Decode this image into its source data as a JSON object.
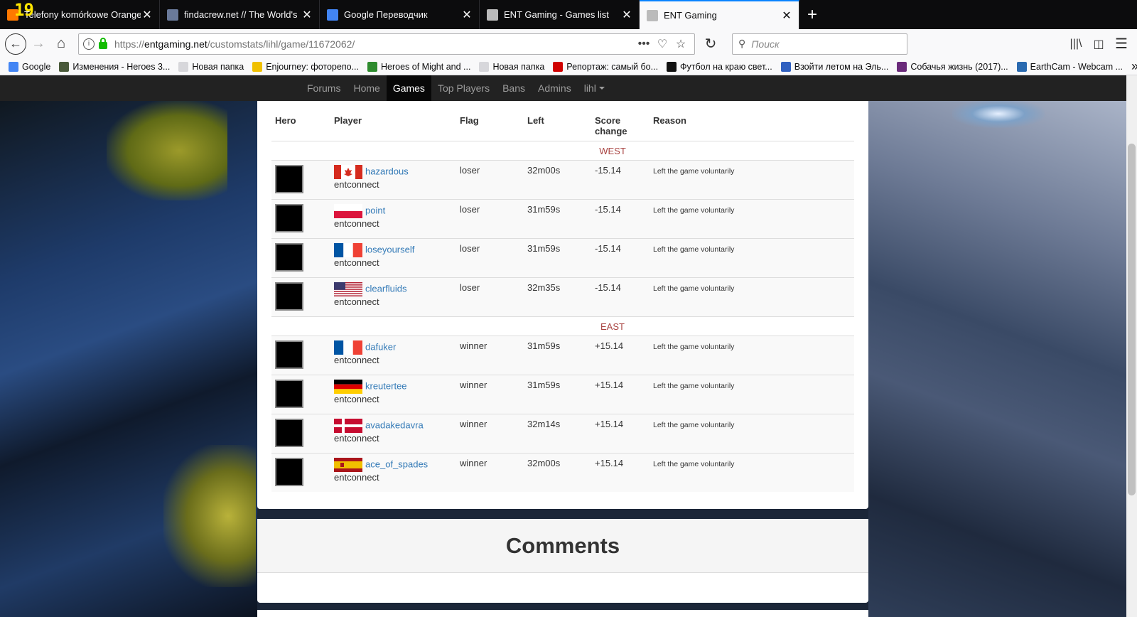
{
  "overlay_logo": "19",
  "browser": {
    "tabs": [
      {
        "title": "Telefony komórkowe Orange -",
        "favicon_color": "#ff7900",
        "active": false
      },
      {
        "title": "findacrew.net // The World's la",
        "favicon_color": "#6a7a9a",
        "active": false
      },
      {
        "title": "Google Переводчик",
        "favicon_color": "#4285f4",
        "active": false
      },
      {
        "title": "ENT Gaming - Games list",
        "favicon_color": "#bbbbbb",
        "active": false
      },
      {
        "title": "ENT Gaming",
        "favicon_color": "#bbbbbb",
        "active": true
      }
    ],
    "close_glyph": "✕",
    "new_tab_glyph": "+",
    "url_prefix": "https://",
    "url_domain": "entgaming.net",
    "url_path": "/customstats/lihl/game/11672062/",
    "search_placeholder": "Поиск",
    "bookmarks": [
      {
        "label": "Google",
        "icon_color": "#4285f4"
      },
      {
        "label": "Изменения - Heroes 3...",
        "icon_color": "#4a5a3a"
      },
      {
        "label": "Новая папка",
        "icon_color": "#d7d7db"
      },
      {
        "label": "Enjourney: фоторепо...",
        "icon_color": "#f0c000"
      },
      {
        "label": "Heroes of Might and ...",
        "icon_color": "#2e8b2e"
      },
      {
        "label": "Новая папка",
        "icon_color": "#d7d7db"
      },
      {
        "label": "Репортаж: самый бо...",
        "icon_color": "#d00000"
      },
      {
        "label": "Футбол на краю свет...",
        "icon_color": "#111111"
      },
      {
        "label": "Взойти летом на Эль...",
        "icon_color": "#3060c0"
      },
      {
        "label": "Собачья жизнь (2017)...",
        "icon_color": "#6a2a7a"
      },
      {
        "label": "EarthCam - Webcam ...",
        "icon_color": "#2a6ab0"
      }
    ]
  },
  "site_nav": {
    "items": [
      "Forums",
      "Home",
      "Games",
      "Top Players",
      "Bans",
      "Admins",
      "lihl"
    ],
    "active": "Games"
  },
  "table": {
    "headers": [
      "Hero",
      "Player",
      "Flag",
      "Left",
      "Score change",
      "Reason"
    ],
    "teams": [
      {
        "name": "WEST",
        "players": [
          {
            "flag": "ca",
            "name": "hazardous",
            "realm": "entconnect",
            "flag_status": "loser",
            "left": "32m00s",
            "score": "-15.14",
            "reason": "Left the game voluntarily"
          },
          {
            "flag": "pl",
            "name": "point",
            "realm": "entconnect",
            "flag_status": "loser",
            "left": "31m59s",
            "score": "-15.14",
            "reason": "Left the game voluntarily"
          },
          {
            "flag": "fr",
            "name": "loseyourself",
            "realm": "entconnect",
            "flag_status": "loser",
            "left": "31m59s",
            "score": "-15.14",
            "reason": "Left the game voluntarily"
          },
          {
            "flag": "us",
            "name": "clearfluids",
            "realm": "entconnect",
            "flag_status": "loser",
            "left": "32m35s",
            "score": "-15.14",
            "reason": "Left the game voluntarily"
          }
        ]
      },
      {
        "name": "EAST",
        "players": [
          {
            "flag": "fr",
            "name": "dafuker",
            "realm": "entconnect",
            "flag_status": "winner",
            "left": "31m59s",
            "score": "+15.14",
            "reason": "Left the game voluntarily"
          },
          {
            "flag": "de",
            "name": "kreutertee",
            "realm": "entconnect",
            "flag_status": "winner",
            "left": "31m59s",
            "score": "+15.14",
            "reason": "Left the game voluntarily"
          },
          {
            "flag": "dk",
            "name": "avadakedavra",
            "realm": "entconnect",
            "flag_status": "winner",
            "left": "32m14s",
            "score": "+15.14",
            "reason": "Left the game voluntarily"
          },
          {
            "flag": "es",
            "name": "ace_of_spades",
            "realm": "entconnect",
            "flag_status": "winner",
            "left": "32m00s",
            "score": "+15.14",
            "reason": "Left the game voluntarily"
          }
        ]
      }
    ]
  },
  "comments_heading": "Comments"
}
